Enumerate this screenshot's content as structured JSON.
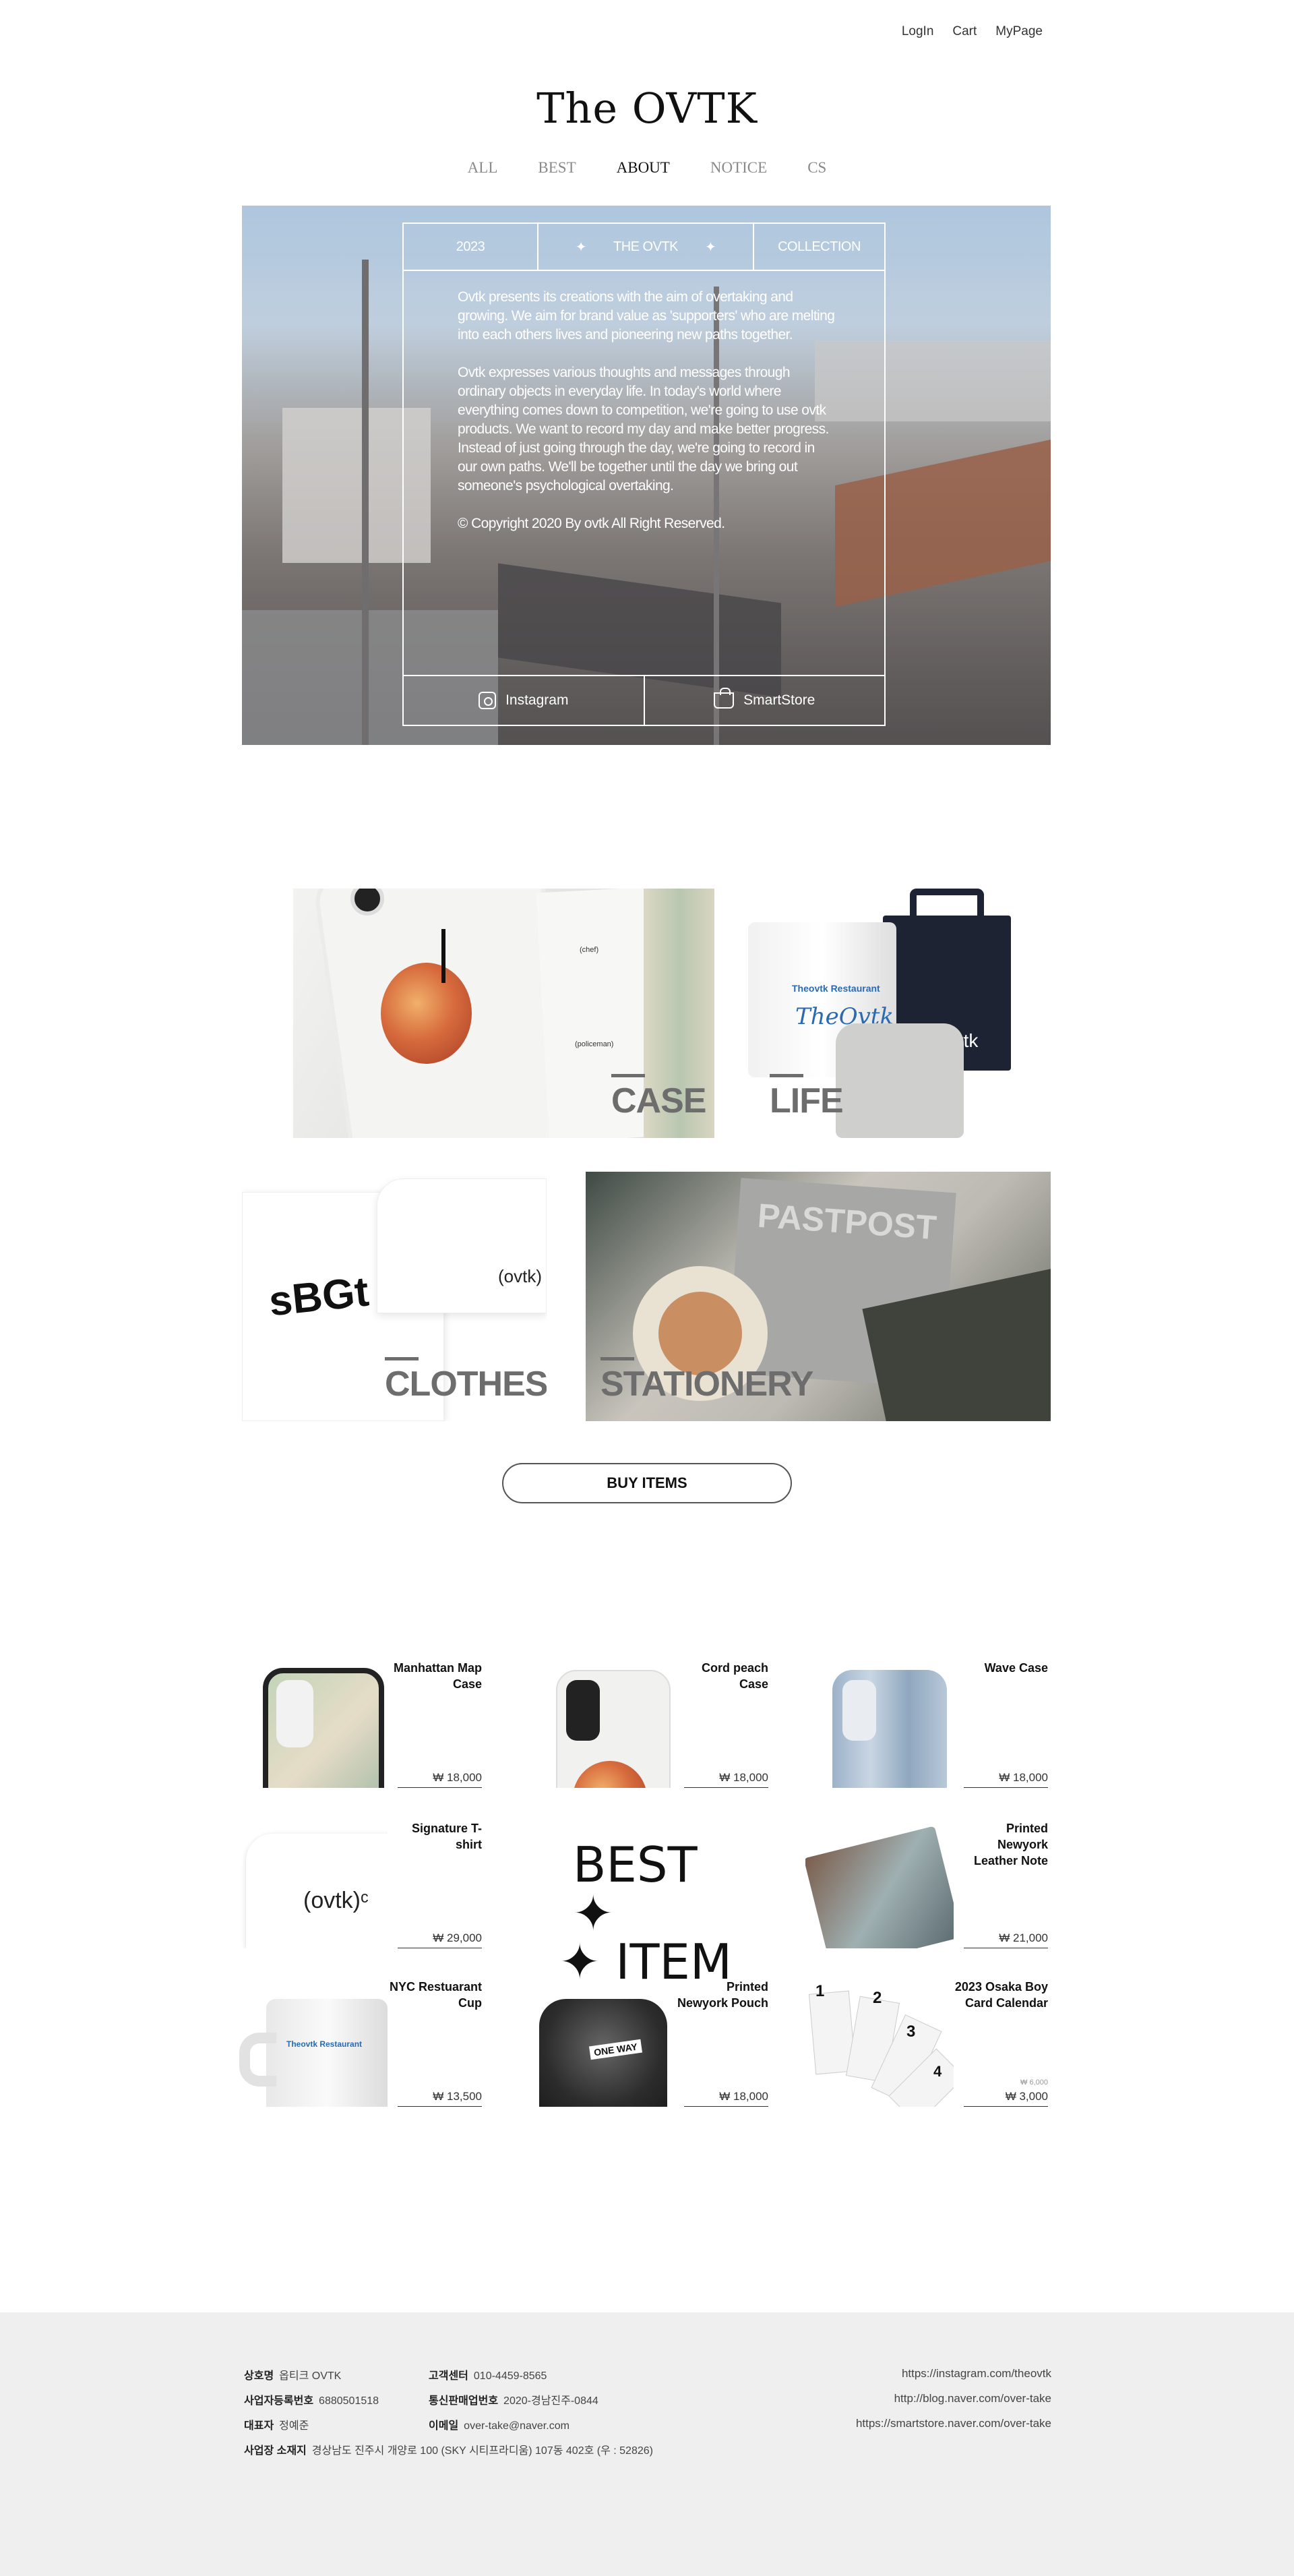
{
  "header": {
    "links": [
      "LogIn",
      "Cart",
      "MyPage"
    ],
    "logo": "The OVTK"
  },
  "nav": {
    "items": [
      "ALL",
      "BEST",
      "ABOUT",
      "NOTICE",
      "CS"
    ],
    "active": "ABOUT"
  },
  "about": {
    "head": {
      "year": "2023",
      "title": "THE OVTK",
      "collection": "COLLECTION",
      "star": "✦"
    },
    "paragraphs": [
      "Ovtk presents its creations with the aim of overtaking and growing. We aim for brand value as 'supporters' who are melting into each others lives and pioneering new paths together.",
      "Ovtk expresses various thoughts and messages through ordinary objects in everyday life. In today's world where everything comes down to competition, we're going to use ovtk products. We want to record my day and make better progress. Instead of just going through the day, we're going to record in our own paths. We'll be together until the day we bring out someone's psychological overtaking.",
      "© Copyright 2020 By ovtk All Right Reserved."
    ],
    "links": {
      "instagram": "Instagram",
      "smartstore": "SmartStore"
    }
  },
  "categories": {
    "case": "CASE",
    "life": "LIFE",
    "clothes": "CLOTHES",
    "stationery": "STATIONERY",
    "buy_button": "BUY ITEMS",
    "mug_brand": "Theovtk Restaurant",
    "mug_script": "TheOvtk",
    "tote_text": "ovtk",
    "shirt_text": "(ovtk)",
    "sbg_text": "sBGt",
    "book_title": "PASTPOST",
    "case_captions": [
      "(chef)",
      "(policeman)"
    ]
  },
  "best": {
    "title_line1": "BEST ✦",
    "title_line2": "✦ ITEM",
    "products": [
      {
        "name": "Manhattan Map Case",
        "price": "₩ 18,000"
      },
      {
        "name": "Cord peach Case",
        "price": "₩ 18,000"
      },
      {
        "name": "Wave Case",
        "price": "₩ 18,000"
      },
      {
        "name": "Signature T-shirt",
        "price": "₩ 29,000"
      },
      {
        "name": "Printed Newyork Leather Note",
        "price": "₩ 21,000"
      },
      {
        "name": "NYC Restuarant Cup",
        "price": "₩ 13,500"
      },
      {
        "name": "Printed Newyork Pouch",
        "price": "₩ 18,000"
      },
      {
        "name": "2023 Osaka Boy Card Calendar",
        "price": "₩ 3,000",
        "old_price": "₩ 6,000"
      }
    ],
    "mug_brand": "Theovtk Restaurant",
    "shirt_text": "(ovtk)ᶜ",
    "calendar_numbers": [
      "1",
      "2",
      "3",
      "4"
    ],
    "pouch_sign": "ONE WAY"
  },
  "footer": {
    "company_label": "상호명",
    "company": "옵티크 OVTK",
    "bizno_label": "사업자등록번호",
    "bizno": "6880501518",
    "ceo_label": "대표자",
    "ceo": "정예준",
    "address_label": "사업장 소재지",
    "address": "경상남도 진주시 개양로 100 (SKY 시티프라디움) 107동 402호 (우 : 52826)",
    "cs_label": "고객센터",
    "cs": "010-4459-8565",
    "mail_order_label": "통신판매업번호",
    "mail_order": "2020-경남진주-0844",
    "email_label": "이메일",
    "email": "over-take@naver.com",
    "links": [
      "https://instagram.com/theovtk",
      "http://blog.naver.com/over-take",
      "https://smartstore.naver.com/over-take"
    ]
  }
}
